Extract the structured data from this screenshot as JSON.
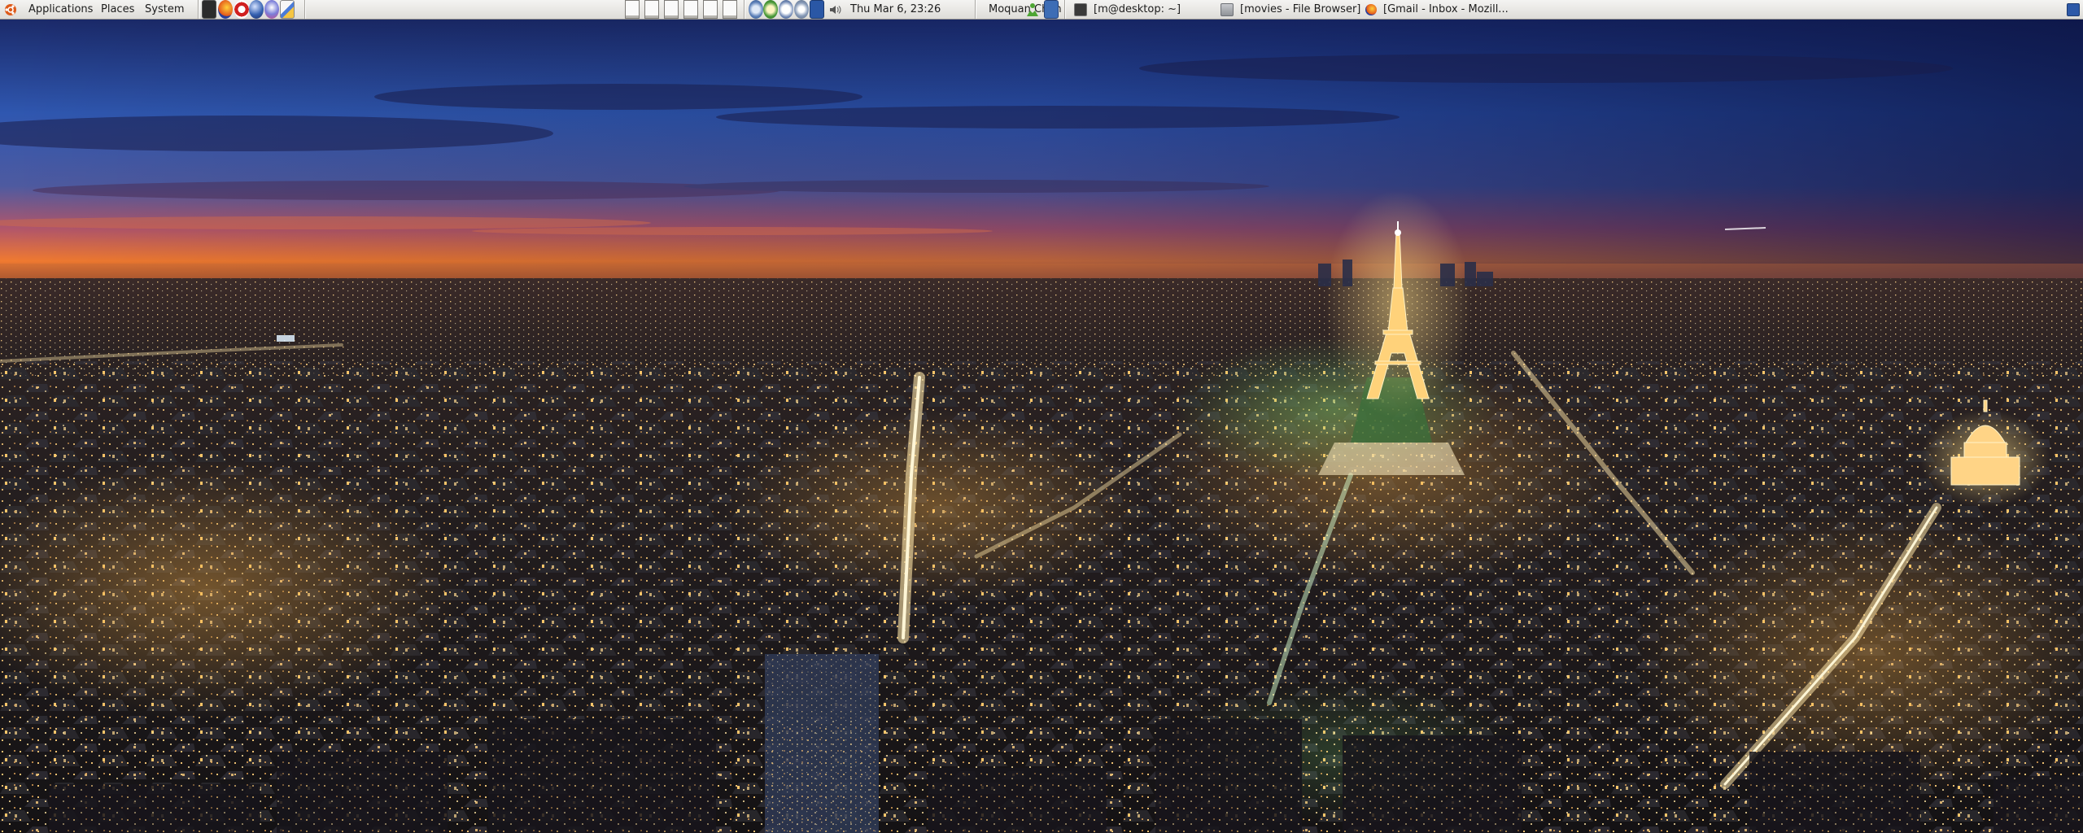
{
  "panel": {
    "menus": {
      "applications": "Applications",
      "places": "Places",
      "system": "System"
    },
    "launchers": [
      "terminal-icon",
      "firefox-icon",
      "help-icon",
      "browser-icon",
      "mail-icon",
      "editor-icon"
    ],
    "clock": "Thu Mar  6, 23:26",
    "user": "Moquan Chen",
    "tasks": [
      {
        "label": "[m@desktop: ~]",
        "icon": "terminal-icon"
      },
      {
        "label": "[movies - File Browser]",
        "icon": "folder-icon"
      },
      {
        "label": "[Gmail - Inbox - Mozill...",
        "icon": "firefox-icon"
      }
    ]
  },
  "colors": {
    "panel_bg": "#e4e2de",
    "sky_top": "#1a2a6c",
    "sky_mid": "#2f5cb8",
    "horizon": "#f07a30",
    "city_glow": "#f4b050",
    "eiffel_light": "#ffd27a"
  },
  "wallpaper": {
    "subject": "paris-night-panorama"
  }
}
